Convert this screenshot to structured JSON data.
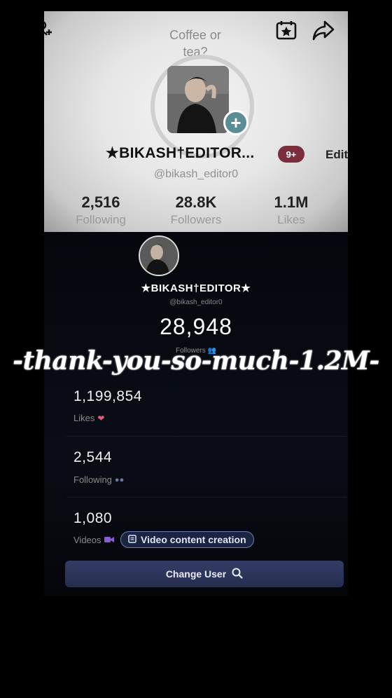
{
  "profile_card": {
    "speech_bubble": "Coffee or tea?",
    "display_name": "★BIKASH†EDITOR...",
    "notification_badge": "9+",
    "edit_label": "Edit",
    "username": "@bikash_editor0",
    "stats": [
      {
        "value": "2,516",
        "label": "Following"
      },
      {
        "value": "28.8K",
        "label": "Followers"
      },
      {
        "value": "1.1M",
        "label": "Likes"
      }
    ],
    "icons": [
      "add-friend-icon",
      "calendar-star-icon",
      "share-icon",
      "add-icon"
    ]
  },
  "analytics": {
    "display_name": "★BIKASH†EDITOR★",
    "username": "@bikash_editor0",
    "followers_count": "28,948",
    "followers_label": "Followers",
    "caption": "-thank-you-so-much-1.2M-",
    "rows": [
      {
        "value": "1,199,854",
        "label": "Likes",
        "icon": "heart-icon"
      },
      {
        "value": "2,544",
        "label": "Following",
        "icon": "people-icon"
      },
      {
        "value": "1,080",
        "label": "Videos",
        "icon": "video-icon"
      }
    ],
    "pill_label": "Video content creation",
    "change_user_label": "Change User"
  },
  "colors": {
    "badge": "#7a2d3d",
    "add_button": "#5d8d94",
    "heart": "#e85a7a",
    "button_bg": "#2b3357",
    "pill_border": "#6c7fb3"
  }
}
